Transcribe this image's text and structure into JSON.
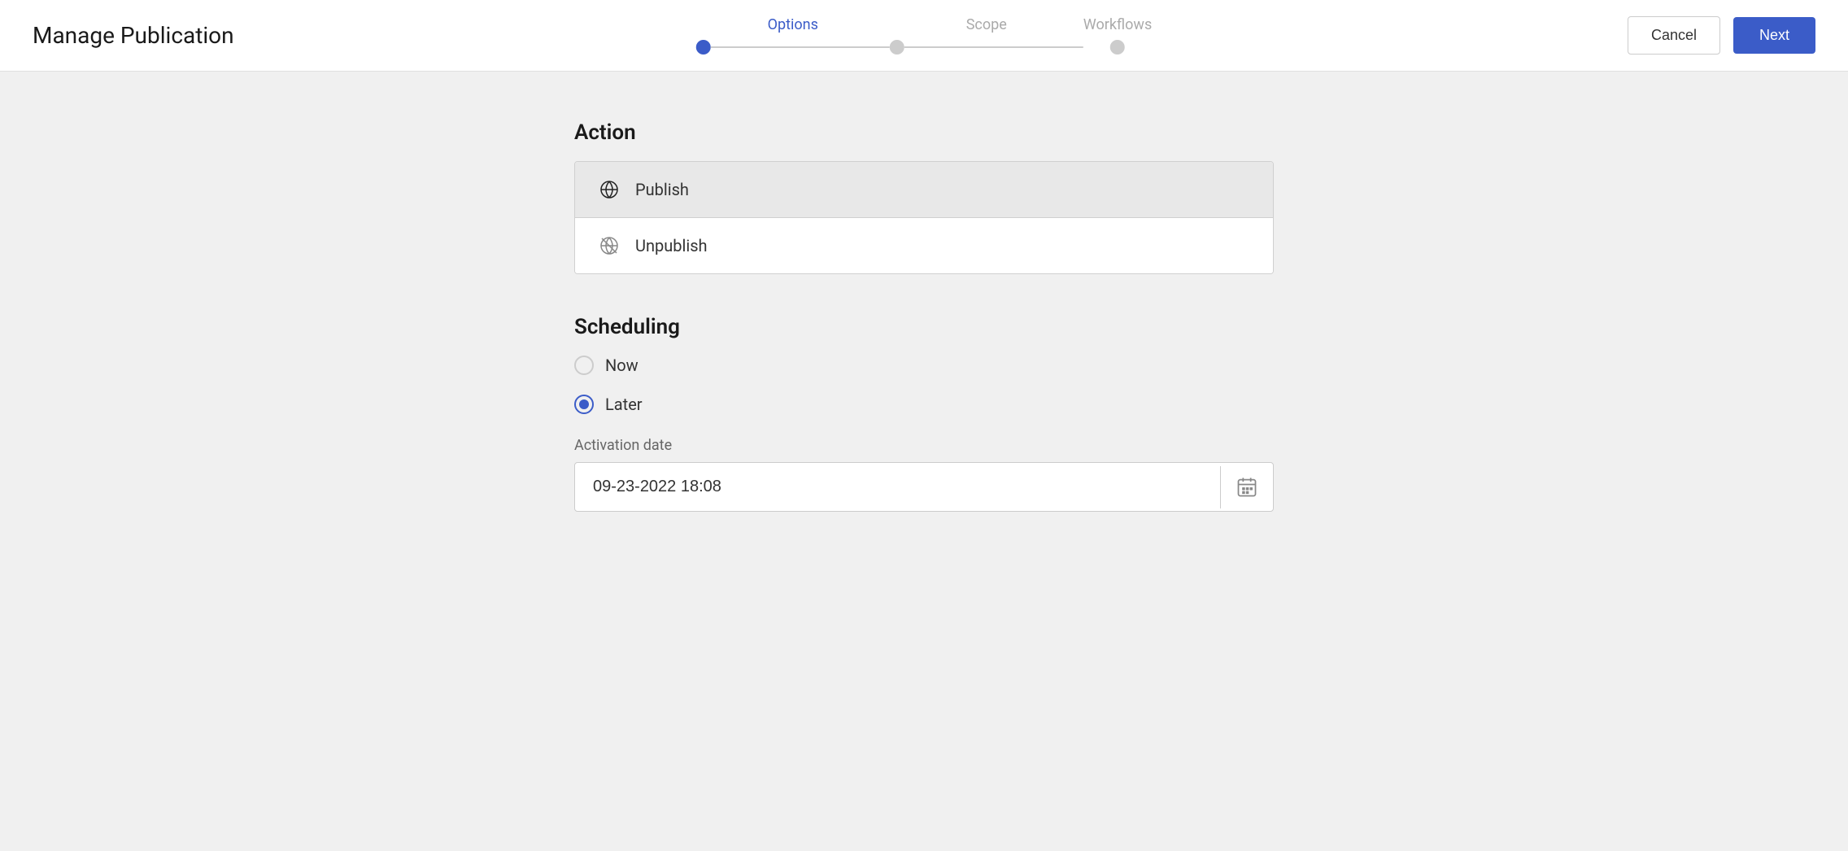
{
  "header": {
    "title": "Manage Publication",
    "cancel_label": "Cancel",
    "next_label": "Next"
  },
  "stepper": {
    "steps": [
      {
        "label": "Options",
        "state": "active"
      },
      {
        "label": "Scope",
        "state": "inactive"
      },
      {
        "label": "Workflows",
        "state": "inactive"
      }
    ]
  },
  "action_section": {
    "title": "Action",
    "items": [
      {
        "label": "Publish",
        "icon": "globe"
      },
      {
        "label": "Unpublish",
        "icon": "globe-off"
      }
    ]
  },
  "scheduling_section": {
    "title": "Scheduling",
    "options": [
      {
        "label": "Now",
        "selected": false
      },
      {
        "label": "Later",
        "selected": true
      }
    ],
    "activation_date_label": "Activation date",
    "activation_date_value": "09-23-2022 18:08"
  }
}
